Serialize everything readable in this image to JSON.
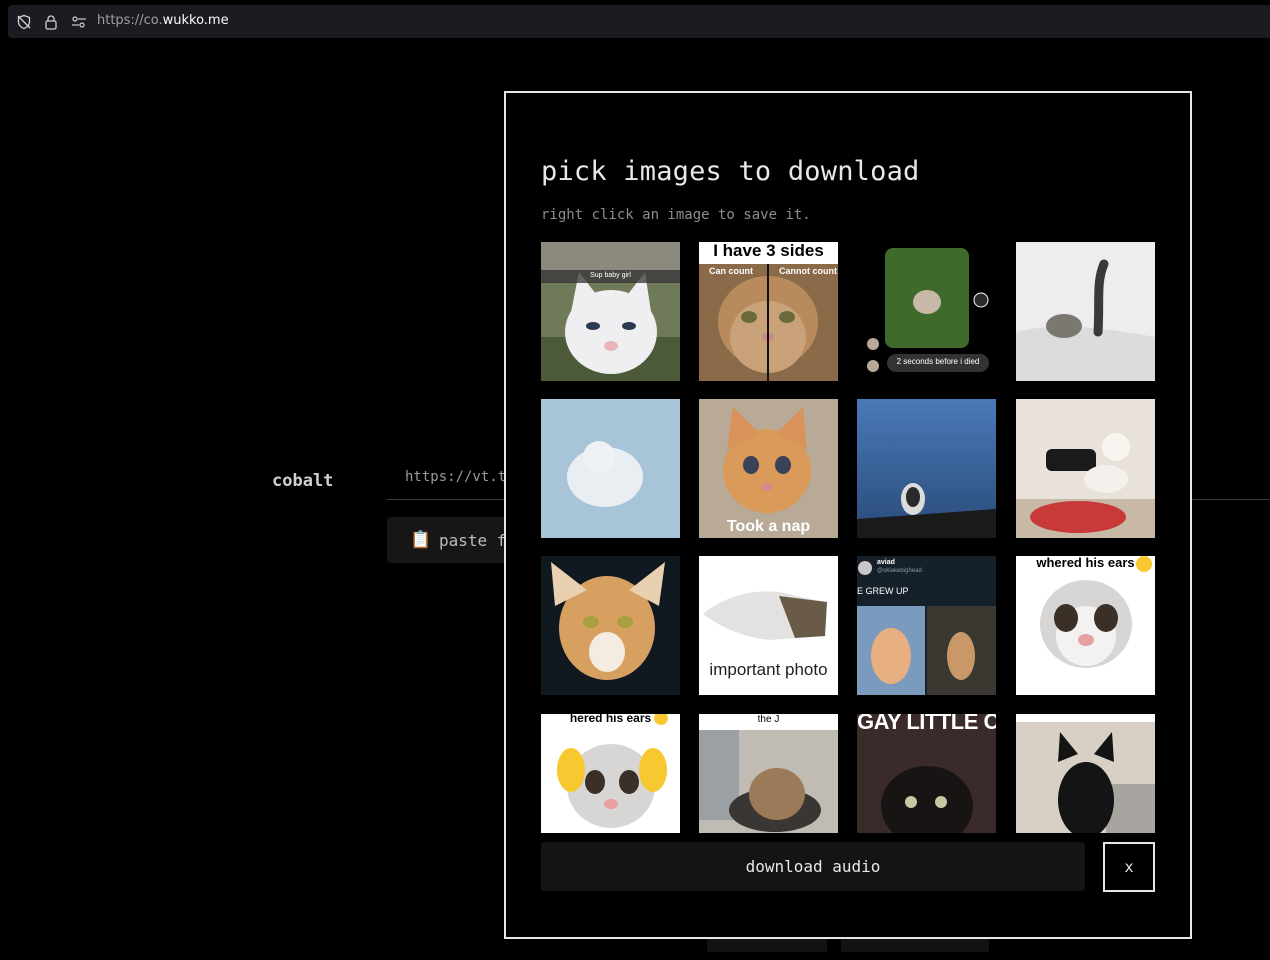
{
  "browser": {
    "url_prefix": "https://co.",
    "url_domain": "wukko.me"
  },
  "background": {
    "brand": "cobalt",
    "input_value": "https://vt.t",
    "paste_label": "paste f",
    "paste_icon": "clipboard-icon"
  },
  "dialog": {
    "title": "pick images to download",
    "subtitle": "right click an image to save it.",
    "images": [
      {
        "caption": "Sup baby girl"
      },
      {
        "caption": "I have 3 sides",
        "left_label": "Can count",
        "right_label": "Cannot count"
      },
      {
        "caption": "2 seconds before i died"
      },
      {
        "caption": ""
      },
      {
        "caption": ""
      },
      {
        "caption": "Took a nap"
      },
      {
        "caption": ""
      },
      {
        "caption": ""
      },
      {
        "caption": ""
      },
      {
        "caption": "important photo"
      },
      {
        "caption": "E GREW UP",
        "user_name": "aviad",
        "user_handle": "@oklakebighead"
      },
      {
        "caption": "whered his ears"
      },
      {
        "caption": "hered his ears"
      },
      {
        "caption": "the J"
      },
      {
        "caption": "GAY LITTLE CAT"
      },
      {
        "caption": ""
      }
    ],
    "download_audio_label": "download audio",
    "close_label": "x"
  }
}
